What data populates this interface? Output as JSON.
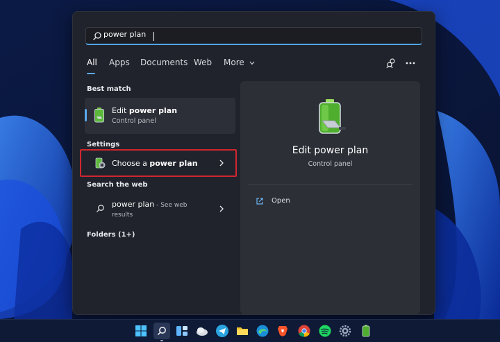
{
  "search": {
    "query": "power plan"
  },
  "tabs": [
    {
      "label": "All",
      "active": true
    },
    {
      "label": "Apps"
    },
    {
      "label": "Documents"
    },
    {
      "label": "Web"
    },
    {
      "label": "More"
    }
  ],
  "toolbar_icons": [
    "account-switch-icon",
    "more-options-icon"
  ],
  "sections": {
    "best_match": "Best match",
    "settings": "Settings",
    "search_web": "Search the web",
    "folders": "Folders (1+)"
  },
  "best_match": {
    "title_prefix": "Edit ",
    "title_bold": "power plan",
    "subtitle": "Control panel"
  },
  "settings_result": {
    "title_prefix": "Choose a ",
    "title_bold": "power plan"
  },
  "web_result": {
    "title": "power plan",
    "suffix": " - See web",
    "line2": "results"
  },
  "preview": {
    "title": "Edit power plan",
    "subtitle": "Control panel",
    "action_label": "Open"
  },
  "taskbar": {
    "items": [
      "start-icon",
      "search-icon",
      "widgets-icon",
      "weather-app-icon",
      "telegram-icon",
      "file-explorer-icon",
      "edge-icon",
      "brave-icon",
      "chrome-icon",
      "spotify-icon",
      "settings-icon",
      "battery-app-icon"
    ]
  },
  "colors": {
    "accent": "#5aa9ec",
    "highlight": "#d1262f",
    "panel": "#20232b"
  }
}
